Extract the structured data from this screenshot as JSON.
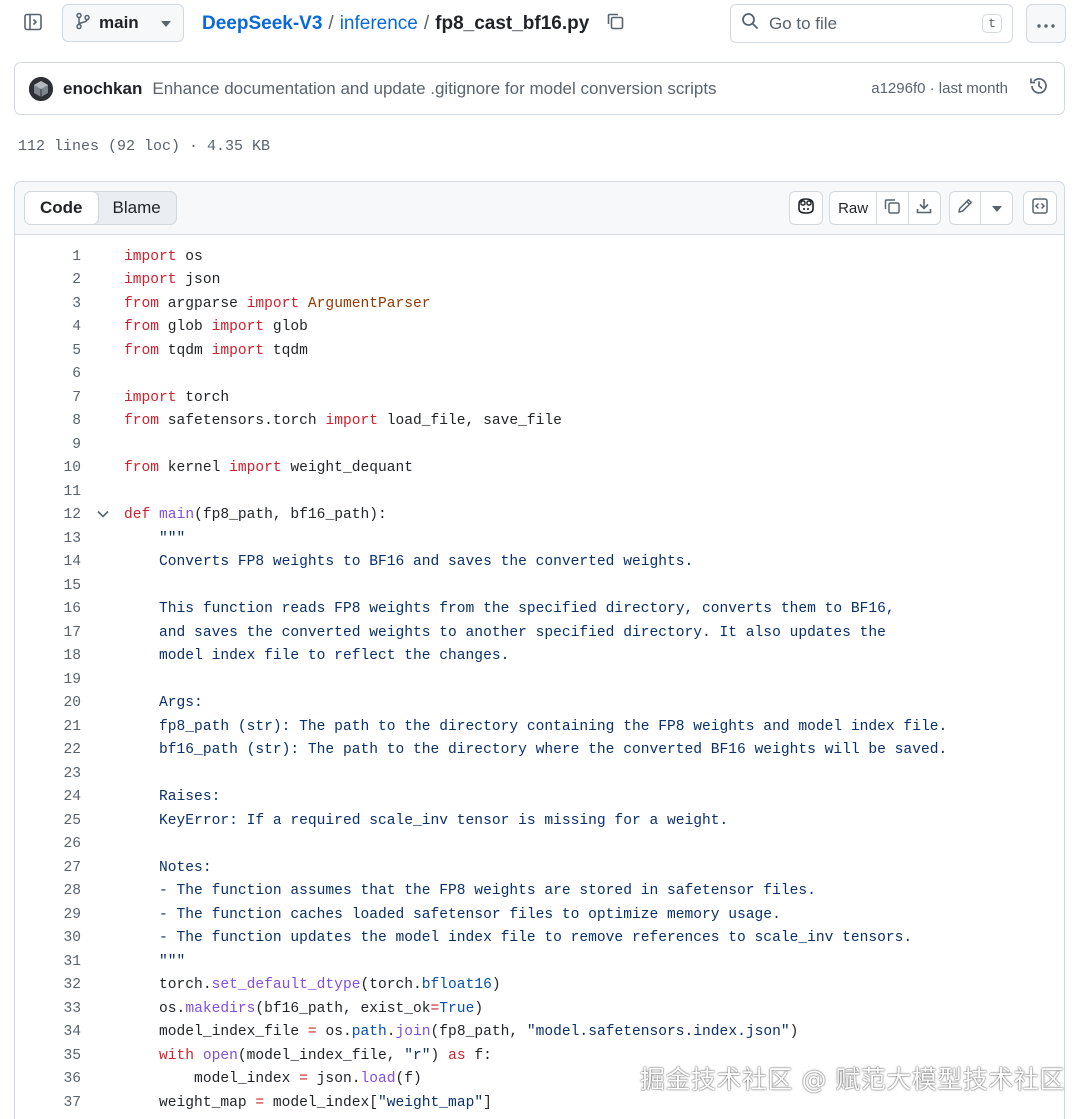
{
  "header": {
    "branch": "main",
    "breadcrumb": {
      "repo": "DeepSeek-V3",
      "sep1": "/",
      "dir": "inference",
      "sep2": "/",
      "file": "fp8_cast_bf16.py"
    },
    "search_placeholder": "Go to file",
    "search_shortcut": "t"
  },
  "commit": {
    "author": "enochkan",
    "message": "Enhance documentation and update .gitignore for model conversion scripts",
    "meta": "a1296f0 · last month"
  },
  "file_stats": "112 lines (92 loc) · 4.35 KB",
  "file_toolbar": {
    "tab_code": "Code",
    "tab_blame": "Blame",
    "raw_label": "Raw"
  },
  "code_lines": [
    {
      "n": "1",
      "fold": false,
      "tokens": [
        {
          "c": "kw",
          "t": "import"
        },
        {
          "c": "",
          "t": " os"
        }
      ]
    },
    {
      "n": "2",
      "fold": false,
      "tokens": [
        {
          "c": "kw",
          "t": "import"
        },
        {
          "c": "",
          "t": " json"
        }
      ]
    },
    {
      "n": "3",
      "fold": false,
      "tokens": [
        {
          "c": "kw",
          "t": "from"
        },
        {
          "c": "",
          "t": " argparse "
        },
        {
          "c": "kw",
          "t": "import"
        },
        {
          "c": "",
          "t": " "
        },
        {
          "c": "ent",
          "t": "ArgumentParser"
        }
      ]
    },
    {
      "n": "4",
      "fold": false,
      "tokens": [
        {
          "c": "kw",
          "t": "from"
        },
        {
          "c": "",
          "t": " glob "
        },
        {
          "c": "kw",
          "t": "import"
        },
        {
          "c": "",
          "t": " glob"
        }
      ]
    },
    {
      "n": "5",
      "fold": false,
      "tokens": [
        {
          "c": "kw",
          "t": "from"
        },
        {
          "c": "",
          "t": " tqdm "
        },
        {
          "c": "kw",
          "t": "import"
        },
        {
          "c": "",
          "t": " tqdm"
        }
      ]
    },
    {
      "n": "6",
      "fold": false,
      "tokens": []
    },
    {
      "n": "7",
      "fold": false,
      "tokens": [
        {
          "c": "kw",
          "t": "import"
        },
        {
          "c": "",
          "t": " torch"
        }
      ]
    },
    {
      "n": "8",
      "fold": false,
      "tokens": [
        {
          "c": "kw",
          "t": "from"
        },
        {
          "c": "",
          "t": " safetensors.torch "
        },
        {
          "c": "kw",
          "t": "import"
        },
        {
          "c": "",
          "t": " load_file, save_file"
        }
      ]
    },
    {
      "n": "9",
      "fold": false,
      "tokens": []
    },
    {
      "n": "10",
      "fold": false,
      "tokens": [
        {
          "c": "kw",
          "t": "from"
        },
        {
          "c": "",
          "t": " kernel "
        },
        {
          "c": "kw",
          "t": "import"
        },
        {
          "c": "",
          "t": " weight_dequant"
        }
      ]
    },
    {
      "n": "11",
      "fold": false,
      "tokens": []
    },
    {
      "n": "12",
      "fold": true,
      "tokens": [
        {
          "c": "kw",
          "t": "def"
        },
        {
          "c": "",
          "t": " "
        },
        {
          "c": "fn",
          "t": "main"
        },
        {
          "c": "",
          "t": "(fp8_path, bf16_path):"
        }
      ]
    },
    {
      "n": "13",
      "fold": false,
      "tokens": [
        {
          "c": "str",
          "t": "    \"\"\""
        }
      ]
    },
    {
      "n": "14",
      "fold": false,
      "tokens": [
        {
          "c": "str",
          "t": "    Converts FP8 weights to BF16 and saves the converted weights."
        }
      ]
    },
    {
      "n": "15",
      "fold": false,
      "tokens": []
    },
    {
      "n": "16",
      "fold": false,
      "tokens": [
        {
          "c": "str",
          "t": "    This function reads FP8 weights from the specified directory, converts them to BF16,"
        }
      ]
    },
    {
      "n": "17",
      "fold": false,
      "tokens": [
        {
          "c": "str",
          "t": "    and saves the converted weights to another specified directory. It also updates the"
        }
      ]
    },
    {
      "n": "18",
      "fold": false,
      "tokens": [
        {
          "c": "str",
          "t": "    model index file to reflect the changes."
        }
      ]
    },
    {
      "n": "19",
      "fold": false,
      "tokens": []
    },
    {
      "n": "20",
      "fold": false,
      "tokens": [
        {
          "c": "str",
          "t": "    Args:"
        }
      ]
    },
    {
      "n": "21",
      "fold": false,
      "tokens": [
        {
          "c": "str",
          "t": "    fp8_path (str): The path to the directory containing the FP8 weights and model index file."
        }
      ]
    },
    {
      "n": "22",
      "fold": false,
      "tokens": [
        {
          "c": "str",
          "t": "    bf16_path (str): The path to the directory where the converted BF16 weights will be saved."
        }
      ]
    },
    {
      "n": "23",
      "fold": false,
      "tokens": []
    },
    {
      "n": "24",
      "fold": false,
      "tokens": [
        {
          "c": "str",
          "t": "    Raises:"
        }
      ]
    },
    {
      "n": "25",
      "fold": false,
      "tokens": [
        {
          "c": "str",
          "t": "    KeyError: If a required scale_inv tensor is missing for a weight."
        }
      ]
    },
    {
      "n": "26",
      "fold": false,
      "tokens": []
    },
    {
      "n": "27",
      "fold": false,
      "tokens": [
        {
          "c": "str",
          "t": "    Notes:"
        }
      ]
    },
    {
      "n": "28",
      "fold": false,
      "tokens": [
        {
          "c": "str",
          "t": "    - The function assumes that the FP8 weights are stored in safetensor files."
        }
      ]
    },
    {
      "n": "29",
      "fold": false,
      "tokens": [
        {
          "c": "str",
          "t": "    - The function caches loaded safetensor files to optimize memory usage."
        }
      ]
    },
    {
      "n": "30",
      "fold": false,
      "tokens": [
        {
          "c": "str",
          "t": "    - The function updates the model index file to remove references to scale_inv tensors."
        }
      ]
    },
    {
      "n": "31",
      "fold": false,
      "tokens": [
        {
          "c": "str",
          "t": "    \"\"\""
        }
      ]
    },
    {
      "n": "32",
      "fold": false,
      "tokens": [
        {
          "c": "",
          "t": "    torch."
        },
        {
          "c": "fn",
          "t": "set_default_dtype"
        },
        {
          "c": "",
          "t": "(torch."
        },
        {
          "c": "cst",
          "t": "bfloat16"
        },
        {
          "c": "",
          "t": ")"
        }
      ]
    },
    {
      "n": "33",
      "fold": false,
      "tokens": [
        {
          "c": "",
          "t": "    os."
        },
        {
          "c": "fn",
          "t": "makedirs"
        },
        {
          "c": "",
          "t": "(bf16_path, exist_ok"
        },
        {
          "c": "kw",
          "t": "="
        },
        {
          "c": "cst",
          "t": "True"
        },
        {
          "c": "",
          "t": ")"
        }
      ]
    },
    {
      "n": "34",
      "fold": false,
      "tokens": [
        {
          "c": "",
          "t": "    model_index_file "
        },
        {
          "c": "kw",
          "t": "="
        },
        {
          "c": "",
          "t": " os."
        },
        {
          "c": "cst",
          "t": "path"
        },
        {
          "c": "",
          "t": "."
        },
        {
          "c": "fn",
          "t": "join"
        },
        {
          "c": "",
          "t": "(fp8_path, "
        },
        {
          "c": "str",
          "t": "\"model.safetensors.index.json\""
        },
        {
          "c": "",
          "t": ")"
        }
      ]
    },
    {
      "n": "35",
      "fold": false,
      "tokens": [
        {
          "c": "",
          "t": "    "
        },
        {
          "c": "kw",
          "t": "with"
        },
        {
          "c": "",
          "t": " "
        },
        {
          "c": "fn",
          "t": "open"
        },
        {
          "c": "",
          "t": "(model_index_file, "
        },
        {
          "c": "str",
          "t": "\"r\""
        },
        {
          "c": "",
          "t": ") "
        },
        {
          "c": "kw",
          "t": "as"
        },
        {
          "c": "",
          "t": " f:"
        }
      ]
    },
    {
      "n": "36",
      "fold": false,
      "tokens": [
        {
          "c": "",
          "t": "        model_index "
        },
        {
          "c": "kw",
          "t": "="
        },
        {
          "c": "",
          "t": " json."
        },
        {
          "c": "fn",
          "t": "load"
        },
        {
          "c": "",
          "t": "(f)"
        }
      ]
    },
    {
      "n": "37",
      "fold": false,
      "tokens": [
        {
          "c": "",
          "t": "    weight_map "
        },
        {
          "c": "kw",
          "t": "="
        },
        {
          "c": "",
          "t": " model_index["
        },
        {
          "c": "str",
          "t": "\"weight_map\""
        },
        {
          "c": "",
          "t": "]"
        }
      ]
    }
  ],
  "watermark": "掘金技术社区 @ 赋范大模型技术社区"
}
